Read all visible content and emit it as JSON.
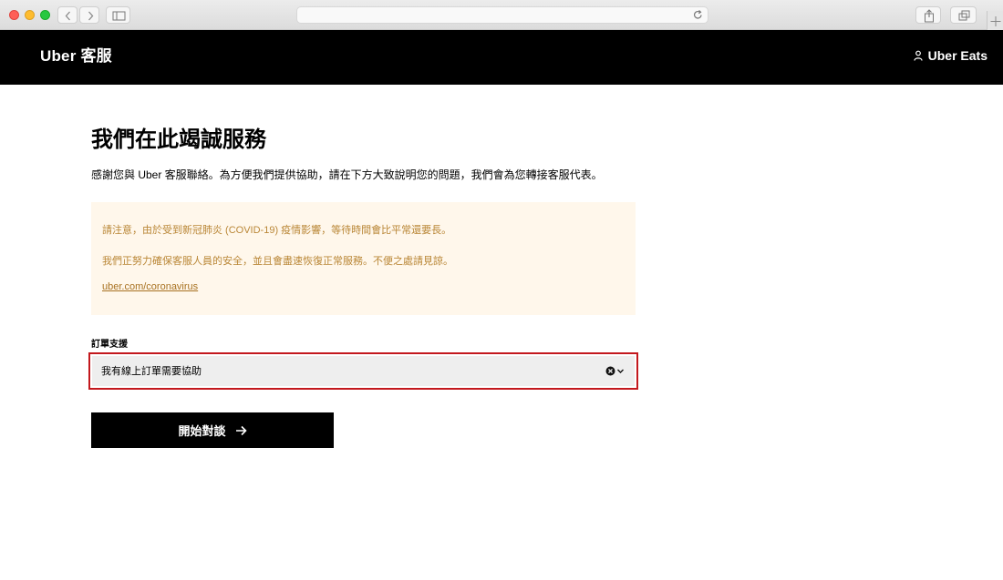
{
  "browser": {
    "address": ""
  },
  "header": {
    "brand": "Uber 客服",
    "eats_link": "Uber Eats"
  },
  "main": {
    "title": "我們在此竭誠服務",
    "subtitle": "感謝您與 Uber 客服聯絡。為方便我們提供協助，請在下方大致說明您的問題，我們會為您轉接客服代表。",
    "notice": {
      "line1": "請注意，由於受到新冠肺炎 (COVID-19) 疫情影響，等待時間會比平常還要長。",
      "line2": "我們正努力確保客服人員的安全，並且會盡速恢復正常服務。不便之處請見諒。",
      "link": "uber.com/coronavirus"
    },
    "support_label": "訂單支援",
    "support_select": {
      "value": "我有線上訂單需要協助"
    },
    "start_button": "開始對談"
  },
  "colors": {
    "header_bg": "#000000",
    "notice_bg": "#fff7eb",
    "notice_text": "#ba8737",
    "select_border": "#c3181d"
  },
  "icons": {
    "back": "chevron-left-icon",
    "forward": "chevron-right-icon",
    "sidebar": "sidebar-icon",
    "reload": "reload-icon",
    "share": "share-icon",
    "tabs": "tabs-icon",
    "new_tab": "plus-icon",
    "user": "user-icon",
    "clear": "clear-circle-icon",
    "chevron": "chevron-down-icon",
    "arrow": "arrow-right-icon"
  }
}
